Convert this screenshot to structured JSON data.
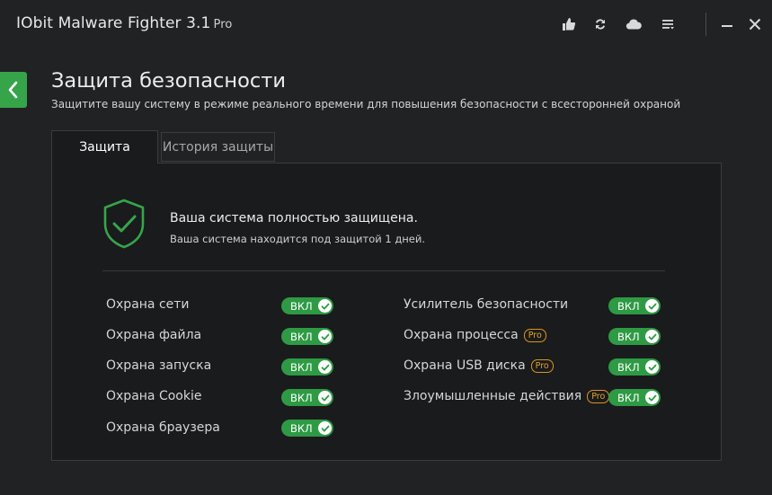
{
  "app": {
    "title": "IObit Malware Fighter 3.1",
    "edition": "Pro"
  },
  "titlebar_icons": [
    "like-icon",
    "update-icon",
    "cloud-icon",
    "menu-icon",
    "minimize-icon",
    "close-icon"
  ],
  "header": {
    "title": "Защита безопасности",
    "subtitle": "Защитите вашу систему в режиме реального времени для повышения безопасности с всесторонней охраной"
  },
  "tabs": [
    {
      "label": "Защита",
      "active": true
    },
    {
      "label": "История защиты",
      "active": false
    }
  ],
  "status": {
    "title": "Ваша система полностью защищена.",
    "subtitle": "Ваша система находится под защитой 1 дней."
  },
  "protections_left": [
    {
      "label": "Охрана сети",
      "state": "ВКЛ",
      "pro": false
    },
    {
      "label": "Охрана файла",
      "state": "ВКЛ",
      "pro": false
    },
    {
      "label": "Охрана запуска",
      "state": "ВКЛ",
      "pro": false
    },
    {
      "label": "Охрана Cookie",
      "state": "ВКЛ",
      "pro": false
    },
    {
      "label": "Охрана браузера",
      "state": "ВКЛ",
      "pro": false
    }
  ],
  "protections_right": [
    {
      "label": "Усилитель безопасности",
      "state": "ВКЛ",
      "pro": false
    },
    {
      "label": "Охрана процесса",
      "state": "ВКЛ",
      "pro": true,
      "badge": "Pro"
    },
    {
      "label": "Охрана USB диска",
      "state": "ВКЛ",
      "pro": true,
      "badge": "Pro"
    },
    {
      "label": "Злоумышленные действия",
      "state": "ВКЛ",
      "pro": true,
      "badge": "Pro"
    }
  ],
  "colors": {
    "accent_green": "#36a54a",
    "pro_badge": "#e0a42a",
    "background": "#202224",
    "panel": "#1a1b1d"
  }
}
